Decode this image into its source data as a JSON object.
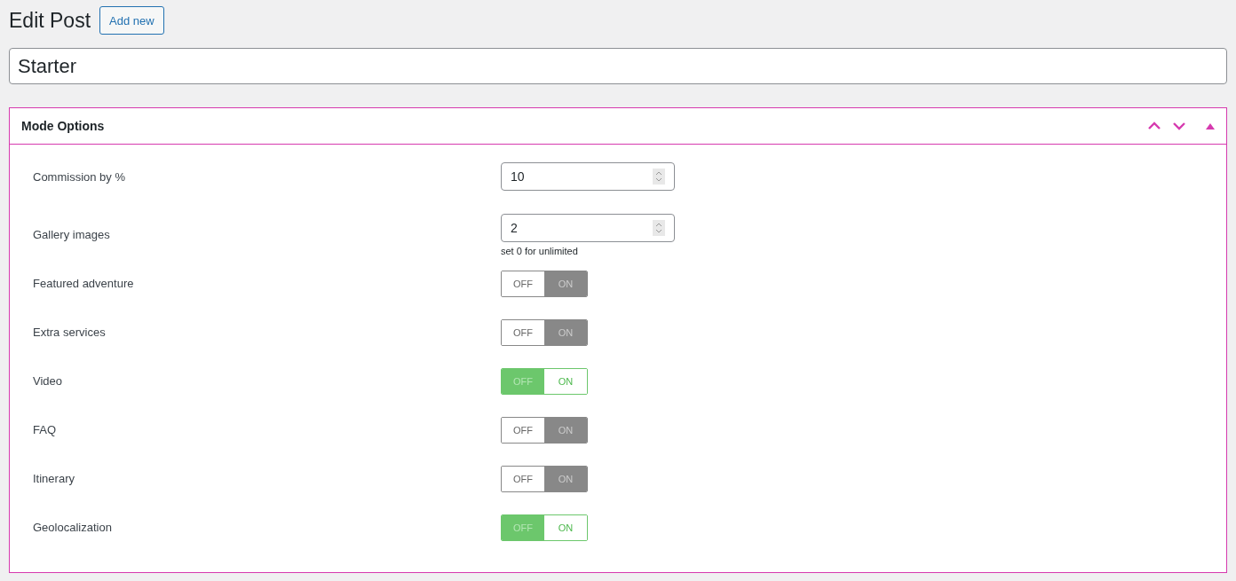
{
  "page_title": "Edit Post",
  "add_new_button": "Add new",
  "post_title": {
    "value": "Starter"
  },
  "panel": {
    "title": "Mode Options",
    "fields": [
      {
        "kind": "number",
        "label": "Commission by %",
        "value": "10"
      },
      {
        "kind": "number",
        "label": "Gallery images",
        "value": "2",
        "hint": "set 0 for unlimited"
      },
      {
        "kind": "toggle",
        "label": "Featured adventure",
        "on": false,
        "off_label": "OFF",
        "on_label": "ON"
      },
      {
        "kind": "toggle",
        "label": "Extra services",
        "on": false,
        "off_label": "OFF",
        "on_label": "ON"
      },
      {
        "kind": "toggle",
        "label": "Video",
        "on": true,
        "off_label": "OFF",
        "on_label": "ON"
      },
      {
        "kind": "toggle",
        "label": "FAQ",
        "on": false,
        "off_label": "OFF",
        "on_label": "ON"
      },
      {
        "kind": "toggle",
        "label": "Itinerary",
        "on": false,
        "off_label": "OFF",
        "on_label": "ON"
      },
      {
        "kind": "toggle",
        "label": "Geolocalization",
        "on": true,
        "off_label": "OFF",
        "on_label": "ON"
      }
    ]
  }
}
